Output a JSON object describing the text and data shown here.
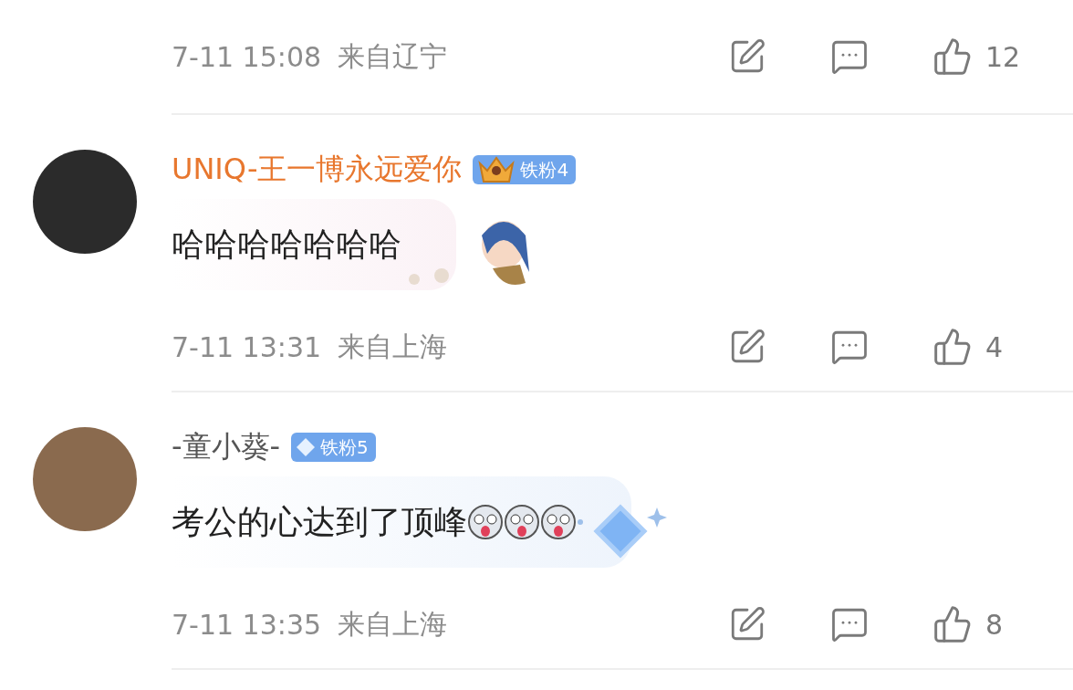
{
  "top_meta": {
    "time": "7-11 15:08",
    "location": "来自辽宁",
    "likes": "12"
  },
  "comments": [
    {
      "name": "UNIQ-王一博永远爱你",
      "vip": true,
      "badge": {
        "kind": "crown",
        "label": "铁粉4"
      },
      "text": "哈哈哈哈哈哈哈",
      "kind": "girl",
      "time": "7-11 13:31",
      "location": "来自上海",
      "likes": "4"
    },
    {
      "name": "-童小葵-",
      "vip": false,
      "badge": {
        "kind": "diamond",
        "label": "铁粉5"
      },
      "text": "考公的心达到了顶峰",
      "kind": "diamond",
      "time": "7-11 13:35",
      "location": "来自上海",
      "likes": "8"
    }
  ]
}
